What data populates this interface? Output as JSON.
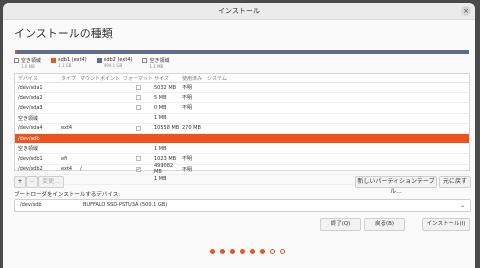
{
  "window": {
    "title": "インストール",
    "close_symbol": "×"
  },
  "page": {
    "title": "インストールの種類"
  },
  "legend": [
    {
      "label": "空き領域",
      "size": "1.0 MB",
      "color": "#ffffff"
    },
    {
      "label": "sdb1 (ext4)",
      "size": "1.1 GB",
      "color": "#e95420"
    },
    {
      "label": "sdb2 (ext4)",
      "size": "499.1 GB",
      "color": "#5f6b87"
    },
    {
      "label": "空き領域",
      "size": "1.1 MB",
      "color": "#ffffff"
    }
  ],
  "table": {
    "headers": [
      "デバイス",
      "タイプ",
      "マウントポイント",
      "フォーマット",
      "サイズ",
      "使用済み",
      "システム"
    ],
    "rows": [
      {
        "device": "/dev/sda1",
        "type": "",
        "mount": "",
        "format": false,
        "size": "5032 MB",
        "used": "不明",
        "system": ""
      },
      {
        "device": "/dev/sda2",
        "type": "",
        "mount": "",
        "format": false,
        "size": "5 MB",
        "used": "不明",
        "system": ""
      },
      {
        "device": "/dev/sda3",
        "type": "",
        "mount": "",
        "format": false,
        "size": "0 MB",
        "used": "不明",
        "system": ""
      },
      {
        "device": "空き領域",
        "type": "",
        "mount": "",
        "format": null,
        "size": "1 MB",
        "used": "",
        "system": ""
      },
      {
        "device": "/dev/sda4",
        "type": "ext4",
        "mount": "",
        "format": false,
        "size": "10558 MB",
        "used": "270 MB",
        "system": ""
      },
      {
        "device": "/dev/sdb",
        "type": "",
        "mount": "",
        "format": null,
        "size": "",
        "used": "",
        "system": ""
      },
      {
        "device": "空き領域",
        "type": "",
        "mount": "",
        "format": null,
        "size": "1 MB",
        "used": "",
        "system": ""
      },
      {
        "device": "/dev/sdb1",
        "type": "efi",
        "mount": "",
        "format": false,
        "size": "1023 MB",
        "used": "不明",
        "system": ""
      },
      {
        "device": "/dev/sdb2",
        "type": "ext4",
        "mount": "/",
        "format": true,
        "size": "499082 MB",
        "used": "不明",
        "system": ""
      },
      {
        "device": "空き領域",
        "type": "",
        "mount": "",
        "format": null,
        "size": "1 MB",
        "used": "",
        "system": ""
      }
    ]
  },
  "toolbar": {
    "add": "+",
    "remove": "−",
    "change": "変更...",
    "new_table": "新しいパーティションテーブル...",
    "revert": "元に戻す"
  },
  "bootloader": {
    "label": "ブートローダをインストールするデバイス:",
    "device": "/dev/sdb",
    "description": "BUFFALO SSD-PSTU3A (500.1 GB)",
    "arrow": "⌄"
  },
  "actions": {
    "quit": "終了(Q)",
    "back": "戻る(B)",
    "install": "インストール(I)"
  },
  "progress": {
    "completed": 6,
    "total": 8
  },
  "colors": {
    "accent": "#e95420",
    "disk_main": "#5f6b87"
  }
}
